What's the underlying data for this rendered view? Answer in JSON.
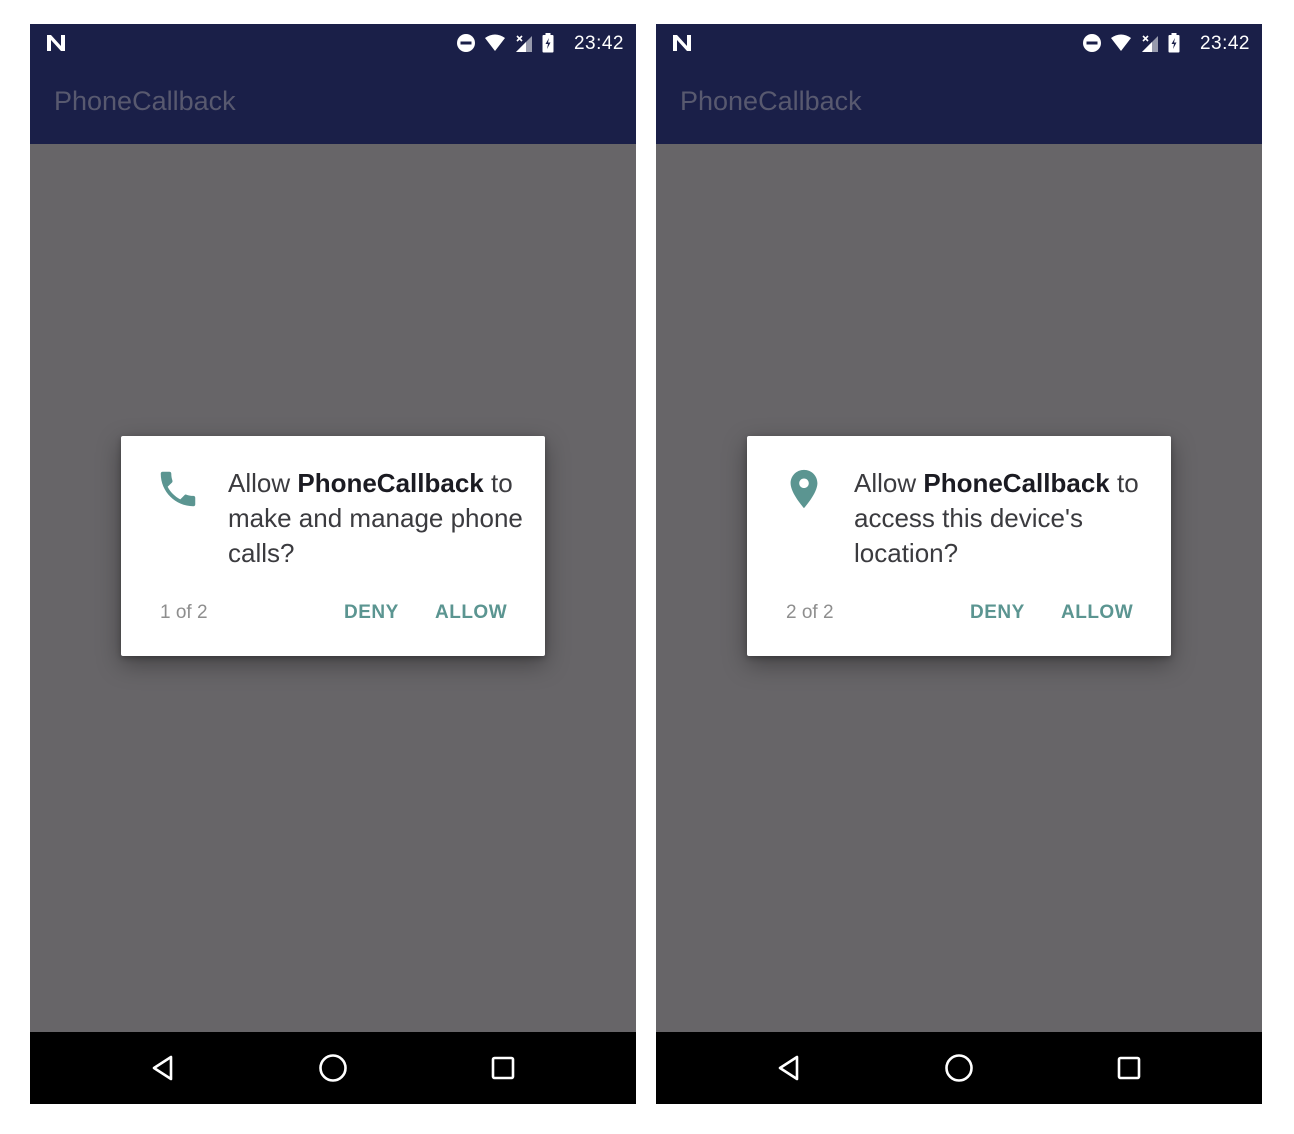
{
  "screens": [
    {
      "status_time": "23:42",
      "app_title": "PhoneCallback",
      "dialog": {
        "icon": "phone-icon",
        "message_prefix": "Allow ",
        "app_name": "PhoneCallback",
        "message_rest": "to make and manage phone calls?",
        "counter": "1 of 2",
        "deny_label": "DENY",
        "allow_label": "ALLOW"
      }
    },
    {
      "status_time": "23:42",
      "app_title": "PhoneCallback",
      "dialog": {
        "icon": "location-pin-icon",
        "message_prefix": "Allow ",
        "app_name": "PhoneCallback",
        "message_rest": "to access this device's location?",
        "counter": "2 of 2",
        "deny_label": "DENY",
        "allow_label": "ALLOW"
      }
    }
  ],
  "colors": {
    "status_bar": "#1a1f48",
    "scrim": "#676568",
    "accent": "#5b9591",
    "nav_bar": "#000000"
  }
}
